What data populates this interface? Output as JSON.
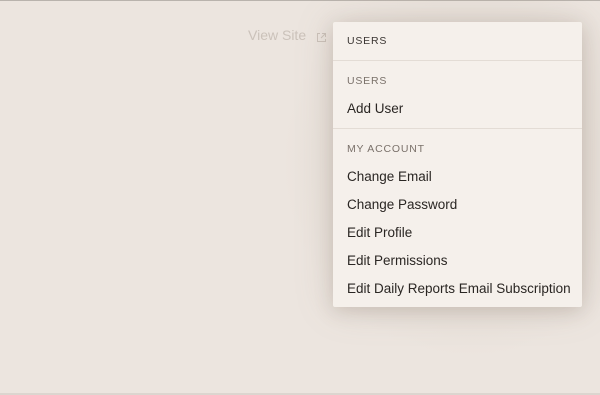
{
  "header": {
    "view_site_label": "View Site",
    "view_site_icon": "external-link-icon"
  },
  "dropdown": {
    "title": "USERS",
    "sections": [
      {
        "label": "USERS",
        "items": [
          "Add User"
        ]
      },
      {
        "label": "MY ACCOUNT",
        "items": [
          "Change Email",
          "Change Password",
          "Edit Profile",
          "Edit Permissions",
          "Edit Daily Reports Email Subscription"
        ]
      }
    ]
  },
  "colors": {
    "background": "#ece5df",
    "dropdown_bg": "#f5f0eb",
    "text_primary": "#2a2623",
    "text_section": "#7a716a",
    "text_muted": "#cbc2ba"
  }
}
